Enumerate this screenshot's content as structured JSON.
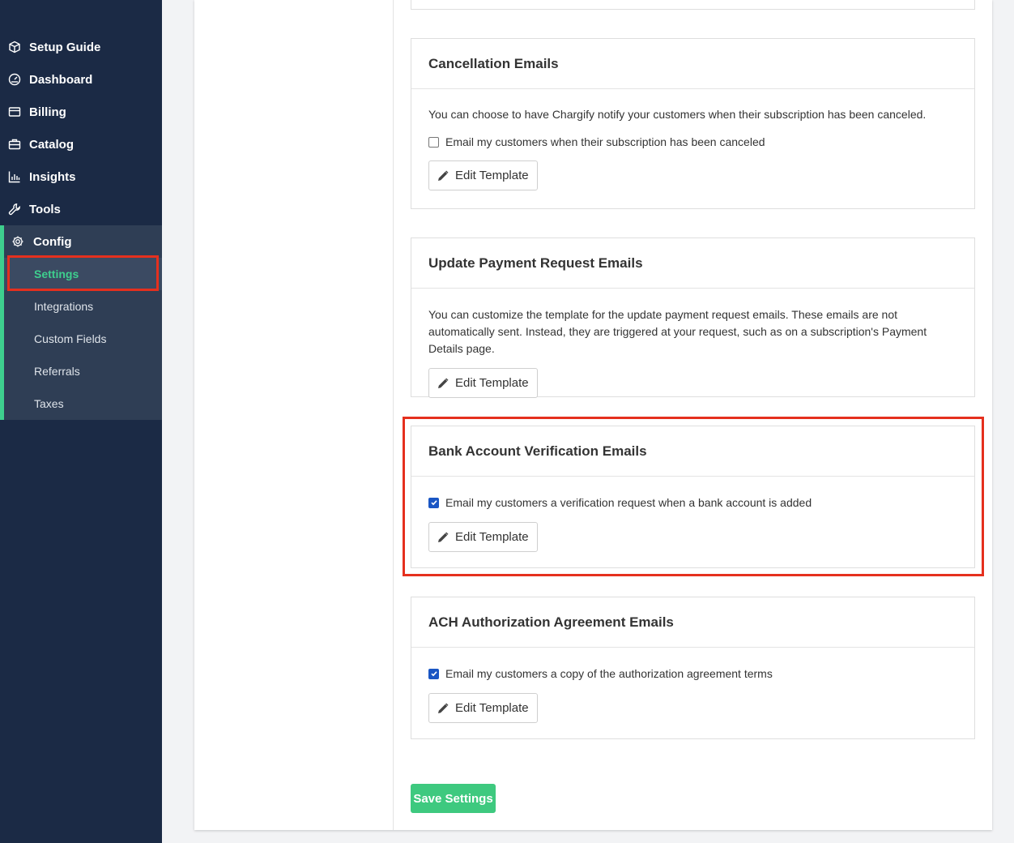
{
  "sidebar": {
    "items": [
      {
        "label": "Setup Guide",
        "icon": "box-icon"
      },
      {
        "label": "Dashboard",
        "icon": "gauge-icon"
      },
      {
        "label": "Billing",
        "icon": "credit-card-icon"
      },
      {
        "label": "Catalog",
        "icon": "briefcase-icon"
      },
      {
        "label": "Insights",
        "icon": "bar-chart-icon"
      },
      {
        "label": "Tools",
        "icon": "wrench-icon"
      }
    ],
    "config": {
      "label": "Config",
      "icon": "gear-icon",
      "sub_items": [
        "Settings",
        "Integrations",
        "Custom Fields",
        "Referrals",
        "Taxes"
      ],
      "active": "Settings"
    },
    "colors": {
      "background": "#1b2a45",
      "accent": "#3ecf8e"
    }
  },
  "cards": {
    "cancellation": {
      "title": "Cancellation Emails",
      "description": "You can choose to have Chargify notify your customers when their subscription has been canceled.",
      "checkbox_label": "Email my customers when their subscription has been canceled",
      "checked": false,
      "button": "Edit Template"
    },
    "update_payment": {
      "title": "Update Payment Request Emails",
      "description": "You can customize the template for the update payment request emails. These emails are not automatically sent. Instead, they are triggered at your request, such as on a subscription's Payment Details page.",
      "button": "Edit Template"
    },
    "bank_verification": {
      "title": "Bank Account Verification Emails",
      "checkbox_label": "Email my customers a verification request when a bank account is added",
      "checked": true,
      "button": "Edit Template"
    },
    "ach_authorization": {
      "title": "ACH Authorization Agreement Emails",
      "checkbox_label": "Email my customers a copy of the authorization agreement terms",
      "checked": true,
      "button": "Edit Template"
    }
  },
  "save_button": "Save Settings",
  "colors": {
    "highlight": "#e5301e",
    "save": "#3ec97f",
    "checkbox": "#1a56c4"
  }
}
